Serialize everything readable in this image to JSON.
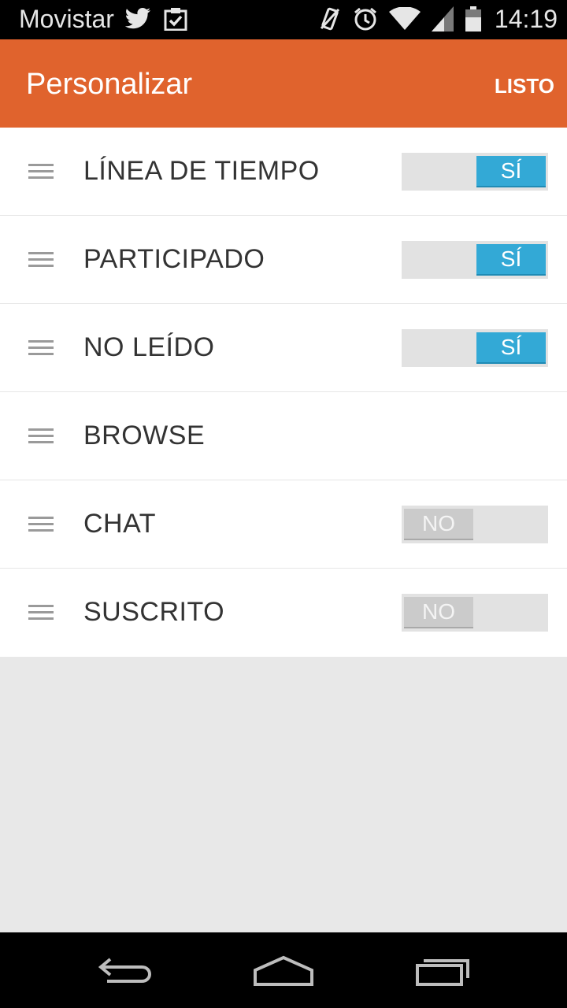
{
  "status_bar": {
    "carrier": "Movistar",
    "time": "14:19",
    "left_icons": [
      "twitter-icon",
      "clipboard-check-icon"
    ],
    "right_icons": [
      "vibrate-off-icon",
      "alarm-icon",
      "wifi-icon",
      "signal-icon",
      "battery-icon"
    ]
  },
  "app_bar": {
    "title": "Personalizar",
    "done_label": "LISTO",
    "color": "#e0632d"
  },
  "rows": [
    {
      "label": "LÍNEA DE TIEMPO",
      "toggle": "SÍ",
      "on": true
    },
    {
      "label": "PARTICIPADO",
      "toggle": "SÍ",
      "on": true
    },
    {
      "label": "NO LEÍDO",
      "toggle": "SÍ",
      "on": true
    },
    {
      "label": "BROWSE",
      "toggle": null,
      "on": null
    },
    {
      "label": "CHAT",
      "toggle": "NO",
      "on": false
    },
    {
      "label": "SUSCRITO",
      "toggle": "NO",
      "on": false
    }
  ],
  "colors": {
    "toggle_on": "#33a9d6",
    "toggle_off": "#cbcbcb"
  },
  "nav_bar": {
    "icons": [
      "back-icon",
      "home-icon",
      "recents-icon"
    ]
  }
}
